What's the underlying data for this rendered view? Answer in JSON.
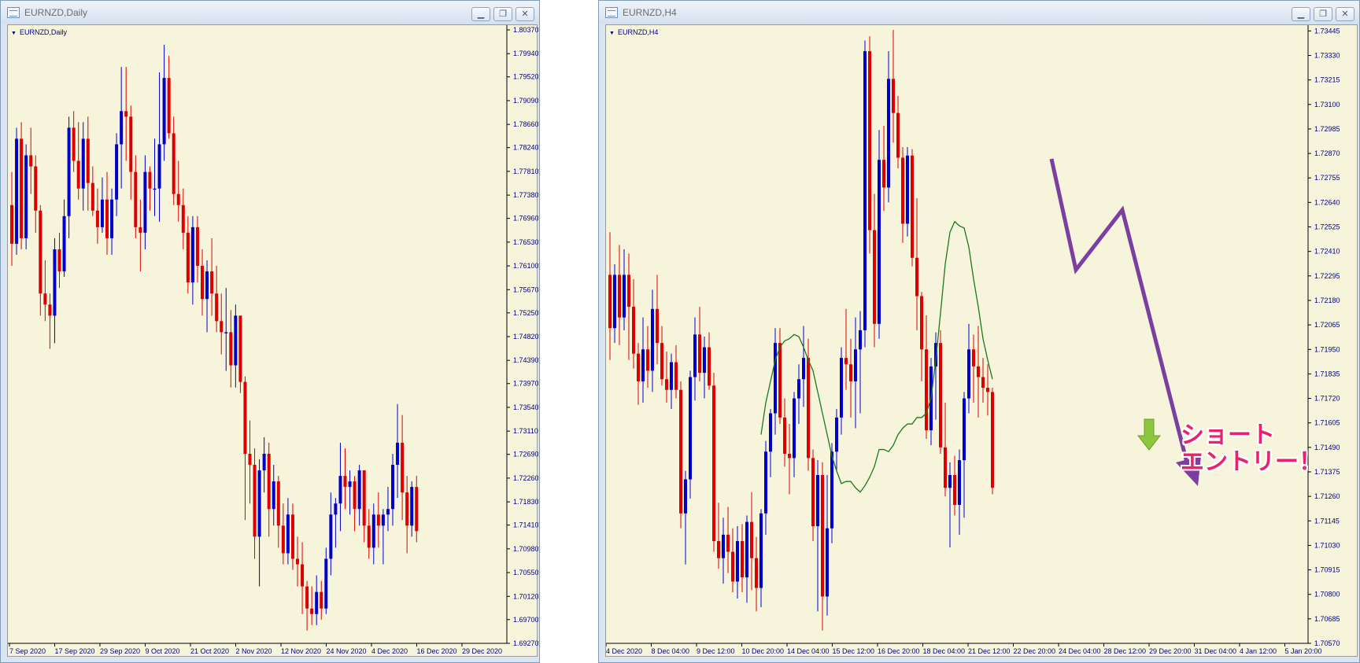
{
  "windows": {
    "daily": {
      "title": "EURNZD,Daily",
      "label": "EURNZD,Daily"
    },
    "h4": {
      "title": "EURNZD,H4",
      "label": "EURNZD,H4"
    }
  },
  "buttons": {
    "minimize": "▁",
    "restore": "❐",
    "close": "✕"
  },
  "annotation": {
    "line1": "ショート",
    "line2": "エントリー！"
  },
  "colors": {
    "bull": "#0000cc",
    "bear": "#dd0000",
    "ma": "#1a7a1a",
    "arrow": "#7a3fa0",
    "entry_arrow": "#8cc63f",
    "background": "#f7f4dc",
    "axis_text": "#000080"
  },
  "chart_data": [
    {
      "type": "candlestick",
      "symbol": "EURNZD",
      "timeframe": "Daily",
      "ylim": [
        1.6927,
        1.8037
      ],
      "y_ticks": [
        1.8037,
        1.7994,
        1.7952,
        1.7909,
        1.7866,
        1.7824,
        1.7781,
        1.7738,
        1.7696,
        1.7653,
        1.761,
        1.7567,
        1.7525,
        1.7482,
        1.7439,
        1.7397,
        1.7354,
        1.7311,
        1.7269,
        1.7226,
        1.7183,
        1.7141,
        1.7098,
        1.7055,
        1.7012,
        1.697,
        1.6927
      ],
      "x_labels": [
        "7 Sep 2020",
        "17 Sep 2020",
        "29 Sep 2020",
        "9 Oct 2020",
        "21 Oct 2020",
        "2 Nov 2020",
        "12 Nov 2020",
        "24 Nov 2020",
        "4 Dec 2020",
        "16 Dec 2020",
        "29 Dec 2020"
      ],
      "candles": [
        [
          1.772,
          1.778,
          1.761,
          1.765
        ],
        [
          1.765,
          1.786,
          1.763,
          1.784
        ],
        [
          1.784,
          1.787,
          1.764,
          1.766
        ],
        [
          1.766,
          1.783,
          1.764,
          1.781
        ],
        [
          1.781,
          1.786,
          1.774,
          1.779
        ],
        [
          1.779,
          1.781,
          1.767,
          1.771
        ],
        [
          1.771,
          1.772,
          1.752,
          1.756
        ],
        [
          1.756,
          1.762,
          1.751,
          1.754
        ],
        [
          1.754,
          1.756,
          1.746,
          1.752
        ],
        [
          1.752,
          1.766,
          1.747,
          1.764
        ],
        [
          1.764,
          1.767,
          1.757,
          1.76
        ],
        [
          1.76,
          1.773,
          1.759,
          1.77
        ],
        [
          1.77,
          1.788,
          1.766,
          1.786
        ],
        [
          1.786,
          1.789,
          1.778,
          1.78
        ],
        [
          1.78,
          1.787,
          1.773,
          1.775
        ],
        [
          1.775,
          1.787,
          1.771,
          1.784
        ],
        [
          1.784,
          1.788,
          1.771,
          1.776
        ],
        [
          1.776,
          1.779,
          1.77,
          1.771
        ],
        [
          1.771,
          1.775,
          1.765,
          1.768
        ],
        [
          1.768,
          1.777,
          1.767,
          1.773
        ],
        [
          1.773,
          1.778,
          1.763,
          1.766
        ],
        [
          1.766,
          1.775,
          1.763,
          1.773
        ],
        [
          1.773,
          1.785,
          1.77,
          1.783
        ],
        [
          1.783,
          1.797,
          1.775,
          1.789
        ],
        [
          1.789,
          1.797,
          1.78,
          1.788
        ],
        [
          1.788,
          1.79,
          1.773,
          1.778
        ],
        [
          1.778,
          1.781,
          1.766,
          1.768
        ],
        [
          1.768,
          1.773,
          1.76,
          1.767
        ],
        [
          1.767,
          1.781,
          1.764,
          1.778
        ],
        [
          1.778,
          1.779,
          1.771,
          1.775
        ],
        [
          1.775,
          1.784,
          1.77,
          1.775
        ],
        [
          1.775,
          1.796,
          1.769,
          1.783
        ],
        [
          1.783,
          1.801,
          1.78,
          1.795
        ],
        [
          1.795,
          1.799,
          1.784,
          1.785
        ],
        [
          1.785,
          1.788,
          1.772,
          1.774
        ],
        [
          1.774,
          1.78,
          1.769,
          1.772
        ],
        [
          1.772,
          1.775,
          1.764,
          1.767
        ],
        [
          1.767,
          1.77,
          1.756,
          1.758
        ],
        [
          1.758,
          1.77,
          1.754,
          1.768
        ],
        [
          1.768,
          1.77,
          1.758,
          1.761
        ],
        [
          1.761,
          1.764,
          1.752,
          1.755
        ],
        [
          1.755,
          1.762,
          1.749,
          1.76
        ],
        [
          1.76,
          1.766,
          1.752,
          1.756
        ],
        [
          1.756,
          1.761,
          1.749,
          1.751
        ],
        [
          1.751,
          1.756,
          1.745,
          1.749
        ],
        [
          1.749,
          1.757,
          1.742,
          1.749
        ],
        [
          1.749,
          1.753,
          1.739,
          1.743
        ],
        [
          1.743,
          1.754,
          1.739,
          1.752
        ],
        [
          1.752,
          1.752,
          1.738,
          1.74
        ],
        [
          1.74,
          1.741,
          1.715,
          1.727
        ],
        [
          1.727,
          1.733,
          1.718,
          1.725
        ],
        [
          1.725,
          1.728,
          1.708,
          1.712
        ],
        [
          1.712,
          1.726,
          1.703,
          1.724
        ],
        [
          1.724,
          1.73,
          1.72,
          1.727
        ],
        [
          1.727,
          1.729,
          1.712,
          1.717
        ],
        [
          1.717,
          1.725,
          1.714,
          1.722
        ],
        [
          1.722,
          1.723,
          1.71,
          1.714
        ],
        [
          1.714,
          1.718,
          1.707,
          1.709
        ],
        [
          1.709,
          1.719,
          1.707,
          1.716
        ],
        [
          1.716,
          1.718,
          1.706,
          1.708
        ],
        [
          1.708,
          1.712,
          1.703,
          1.707
        ],
        [
          1.707,
          1.711,
          1.698,
          1.703
        ],
        [
          1.703,
          1.704,
          1.695,
          1.699
        ],
        [
          1.699,
          1.703,
          1.696,
          1.698
        ],
        [
          1.698,
          1.705,
          1.696,
          1.702
        ],
        [
          1.702,
          1.704,
          1.697,
          1.699
        ],
        [
          1.699,
          1.71,
          1.698,
          1.708
        ],
        [
          1.708,
          1.72,
          1.705,
          1.716
        ],
        [
          1.716,
          1.719,
          1.71,
          1.718
        ],
        [
          1.718,
          1.729,
          1.713,
          1.723
        ],
        [
          1.723,
          1.728,
          1.717,
          1.721
        ],
        [
          1.721,
          1.724,
          1.716,
          1.722
        ],
        [
          1.722,
          1.723,
          1.713,
          1.717
        ],
        [
          1.717,
          1.725,
          1.714,
          1.724
        ],
        [
          1.724,
          1.724,
          1.711,
          1.714
        ],
        [
          1.714,
          1.717,
          1.708,
          1.71
        ],
        [
          1.71,
          1.718,
          1.707,
          1.716
        ],
        [
          1.716,
          1.72,
          1.71,
          1.714
        ],
        [
          1.714,
          1.717,
          1.707,
          1.716
        ],
        [
          1.716,
          1.721,
          1.713,
          1.717
        ],
        [
          1.717,
          1.727,
          1.714,
          1.725
        ],
        [
          1.725,
          1.736,
          1.719,
          1.729
        ],
        [
          1.729,
          1.734,
          1.715,
          1.72
        ],
        [
          1.72,
          1.723,
          1.709,
          1.714
        ],
        [
          1.714,
          1.722,
          1.712,
          1.721
        ],
        [
          1.721,
          1.723,
          1.711,
          1.713
        ]
      ]
    },
    {
      "type": "candlestick",
      "symbol": "EURNZD",
      "timeframe": "H4",
      "ylim": [
        1.7057,
        1.7345
      ],
      "y_ticks": [
        1.73445,
        1.7333,
        1.73215,
        1.731,
        1.72985,
        1.7287,
        1.72755,
        1.7264,
        1.72525,
        1.7241,
        1.72295,
        1.7218,
        1.72065,
        1.7195,
        1.71835,
        1.7172,
        1.71605,
        1.7149,
        1.71375,
        1.7126,
        1.71145,
        1.7103,
        1.70915,
        1.708,
        1.70685,
        1.7057
      ],
      "x_labels": [
        "4 Dec 2020",
        "8 Dec 04:00",
        "9 Dec 12:00",
        "10 Dec 20:00",
        "14 Dec 04:00",
        "15 Dec 12:00",
        "16 Dec 20:00",
        "18 Dec 04:00",
        "21 Dec 12:00",
        "22 Dec 20:00",
        "24 Dec 04:00",
        "28 Dec 12:00",
        "29 Dec 20:00",
        "31 Dec 04:00",
        "4 Jan 12:00",
        "5 Jan 20:00"
      ],
      "candles": [
        [
          1.723,
          1.725,
          1.719,
          1.7205
        ],
        [
          1.7205,
          1.7235,
          1.7198,
          1.723
        ],
        [
          1.723,
          1.7244,
          1.7197,
          1.721
        ],
        [
          1.721,
          1.7242,
          1.7204,
          1.723
        ],
        [
          1.723,
          1.724,
          1.719,
          1.7215
        ],
        [
          1.7215,
          1.7228,
          1.7186,
          1.7193
        ],
        [
          1.7193,
          1.7198,
          1.7169,
          1.718
        ],
        [
          1.718,
          1.721,
          1.717,
          1.7195
        ],
        [
          1.7195,
          1.7206,
          1.7177,
          1.7185
        ],
        [
          1.7185,
          1.7223,
          1.7175,
          1.7214
        ],
        [
          1.7214,
          1.723,
          1.7188,
          1.7198
        ],
        [
          1.7198,
          1.7206,
          1.7178,
          1.7181
        ],
        [
          1.7181,
          1.7194,
          1.717,
          1.7176
        ],
        [
          1.7176,
          1.7193,
          1.7167,
          1.7189
        ],
        [
          1.7189,
          1.7197,
          1.7172,
          1.7176
        ],
        [
          1.7176,
          1.718,
          1.7111,
          1.7118
        ],
        [
          1.7118,
          1.7138,
          1.7094,
          1.7134
        ],
        [
          1.7134,
          1.7185,
          1.7125,
          1.7182
        ],
        [
          1.7182,
          1.721,
          1.7171,
          1.7202
        ],
        [
          1.7202,
          1.7215,
          1.718,
          1.7184
        ],
        [
          1.7184,
          1.7201,
          1.7172,
          1.7196
        ],
        [
          1.7196,
          1.7203,
          1.7176,
          1.7178
        ],
        [
          1.7178,
          1.7184,
          1.71,
          1.7105
        ],
        [
          1.7105,
          1.7123,
          1.7092,
          1.7097
        ],
        [
          1.7097,
          1.7116,
          1.7085,
          1.7108
        ],
        [
          1.7108,
          1.7121,
          1.709,
          1.71
        ],
        [
          1.71,
          1.7111,
          1.7081,
          1.7086
        ],
        [
          1.7086,
          1.7112,
          1.7078,
          1.7105
        ],
        [
          1.7105,
          1.7113,
          1.7081,
          1.7088
        ],
        [
          1.7088,
          1.7117,
          1.7076,
          1.7114
        ],
        [
          1.7114,
          1.7128,
          1.7082,
          1.7097
        ],
        [
          1.7097,
          1.7107,
          1.7072,
          1.7083
        ],
        [
          1.7083,
          1.712,
          1.7074,
          1.7118
        ],
        [
          1.7118,
          1.7152,
          1.7108,
          1.7147
        ],
        [
          1.7147,
          1.7167,
          1.7135,
          1.7165
        ],
        [
          1.7165,
          1.7205,
          1.7155,
          1.7198
        ],
        [
          1.7198,
          1.7205,
          1.716,
          1.7163
        ],
        [
          1.7163,
          1.7172,
          1.714,
          1.7146
        ],
        [
          1.7146,
          1.716,
          1.7127,
          1.7144
        ],
        [
          1.7144,
          1.7175,
          1.7135,
          1.7172
        ],
        [
          1.7172,
          1.7188,
          1.716,
          1.7181
        ],
        [
          1.7181,
          1.7206,
          1.7168,
          1.7191
        ],
        [
          1.7191,
          1.72,
          1.7138,
          1.7144
        ],
        [
          1.7144,
          1.7148,
          1.7105,
          1.7112
        ],
        [
          1.7112,
          1.7143,
          1.7072,
          1.7136
        ],
        [
          1.7136,
          1.7142,
          1.7063,
          1.7079
        ],
        [
          1.7079,
          1.7136,
          1.707,
          1.7111
        ],
        [
          1.7111,
          1.7151,
          1.7104,
          1.7147
        ],
        [
          1.7147,
          1.7167,
          1.7138,
          1.7163
        ],
        [
          1.7163,
          1.7196,
          1.7155,
          1.7191
        ],
        [
          1.7191,
          1.7214,
          1.7176,
          1.7188
        ],
        [
          1.7188,
          1.72,
          1.7163,
          1.718
        ],
        [
          1.718,
          1.721,
          1.7158,
          1.7195
        ],
        [
          1.7195,
          1.7213,
          1.7165,
          1.7204
        ],
        [
          1.7204,
          1.734,
          1.7196,
          1.7335
        ],
        [
          1.7335,
          1.7342,
          1.724,
          1.7251
        ],
        [
          1.7251,
          1.7268,
          1.7196,
          1.7207
        ],
        [
          1.7207,
          1.7298,
          1.72,
          1.7284
        ],
        [
          1.7284,
          1.73,
          1.726,
          1.7271
        ],
        [
          1.7271,
          1.7335,
          1.7264,
          1.7322
        ],
        [
          1.7322,
          1.7345,
          1.7292,
          1.7306
        ],
        [
          1.7306,
          1.7314,
          1.728,
          1.7285
        ],
        [
          1.7285,
          1.729,
          1.7245,
          1.7254
        ],
        [
          1.7254,
          1.729,
          1.7248,
          1.7286
        ],
        [
          1.7286,
          1.7289,
          1.7234,
          1.7238
        ],
        [
          1.7238,
          1.7266,
          1.7204,
          1.722
        ],
        [
          1.722,
          1.7222,
          1.718,
          1.7195
        ],
        [
          1.7195,
          1.7211,
          1.7153,
          1.7157
        ],
        [
          1.7157,
          1.7191,
          1.715,
          1.7187
        ],
        [
          1.7187,
          1.7203,
          1.7162,
          1.7198
        ],
        [
          1.7198,
          1.7204,
          1.7146,
          1.7149
        ],
        [
          1.7149,
          1.717,
          1.7126,
          1.713
        ],
        [
          1.713,
          1.7142,
          1.7102,
          1.7136
        ],
        [
          1.7136,
          1.7145,
          1.7117,
          1.7122
        ],
        [
          1.7122,
          1.7148,
          1.7108,
          1.7143
        ],
        [
          1.7143,
          1.7175,
          1.7116,
          1.7172
        ],
        [
          1.7172,
          1.7207,
          1.7165,
          1.7195
        ],
        [
          1.7195,
          1.7202,
          1.717,
          1.7187
        ],
        [
          1.7187,
          1.7206,
          1.7163,
          1.7182
        ],
        [
          1.7182,
          1.7191,
          1.717,
          1.7177
        ],
        [
          1.7177,
          1.7188,
          1.7164,
          1.7175
        ],
        [
          1.7175,
          1.7177,
          1.7127,
          1.713
        ]
      ],
      "ma": [
        1.7155,
        1.717,
        1.718,
        1.719,
        1.7196,
        1.7199,
        1.72,
        1.7202,
        1.7201,
        1.7196,
        1.719,
        1.7185,
        1.7175,
        1.7165,
        1.7155,
        1.7145,
        1.7138,
        1.7132,
        1.7133,
        1.7133,
        1.713,
        1.7128,
        1.7131,
        1.7135,
        1.714,
        1.7148,
        1.7148,
        1.7147,
        1.715,
        1.7155,
        1.7158,
        1.716,
        1.716,
        1.7163,
        1.7163,
        1.7165,
        1.7172,
        1.719,
        1.7212,
        1.7235,
        1.725,
        1.7255,
        1.7253,
        1.7252,
        1.7243,
        1.7228,
        1.7215,
        1.72,
        1.719,
        1.7181
      ]
    }
  ]
}
